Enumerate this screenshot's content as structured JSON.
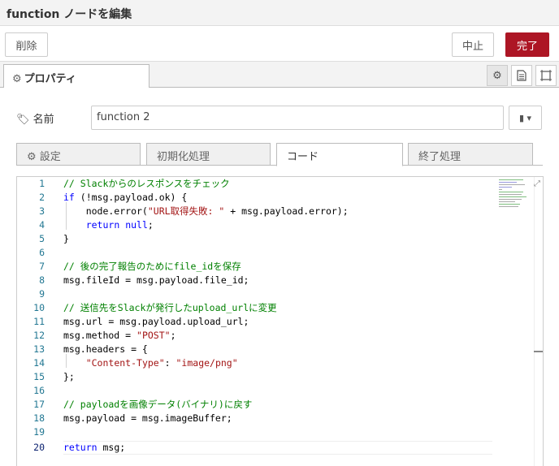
{
  "header": {
    "title": "function ノードを編集"
  },
  "toolbar": {
    "delete_label": "削除",
    "cancel_label": "中止",
    "done_label": "完了"
  },
  "tabs": {
    "properties_label": "プロパティ"
  },
  "form": {
    "name_label": "名前",
    "name_value": "function 2"
  },
  "subtabs": [
    "設定",
    "初期化処理",
    "コード",
    "終了処理"
  ],
  "editor": {
    "lines": [
      "1",
      "2",
      "3",
      "4",
      "5",
      "6",
      "7",
      "8",
      "9",
      "10",
      "11",
      "12",
      "13",
      "14",
      "15",
      "16",
      "17",
      "18",
      "19",
      "20"
    ]
  },
  "colors": {
    "accent": "#ad1625",
    "comment": "#008000",
    "keyword": "#0000ff",
    "string": "#a31515",
    "line_number": "#237893"
  }
}
